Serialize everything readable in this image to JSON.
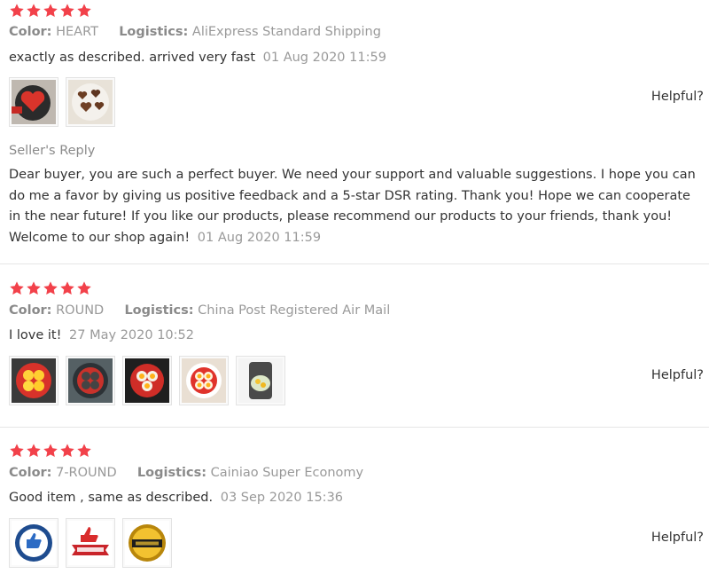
{
  "colors": {
    "star": "#f2414a",
    "text": "#333333",
    "muted": "#999999"
  },
  "reviews": [
    {
      "rating": 5,
      "color_label": "Color:",
      "color_value": "HEART",
      "logistics_label": "Logistics:",
      "logistics_value": "AliExpress Standard Shipping",
      "text": "exactly as described. arrived very fast",
      "date": "01 Aug 2020 11:59",
      "photos": [
        "pan-heart-photo",
        "heart-pancakes-photo"
      ],
      "helpful": "Helpful?",
      "seller_reply": {
        "title": "Seller's Reply",
        "text": "Dear buyer, you are such a perfect buyer. We need your support and valuable suggestions. I hope you can do me a favor by giving us positive feedback and a 5-star DSR rating. Thank you! Hope we can cooperate in the near future! If you like our products, please recommend our products to your friends, thank you! Welcome to our shop again!",
        "date": "01 Aug 2020 11:59"
      }
    },
    {
      "rating": 5,
      "color_label": "Color:",
      "color_value": "ROUND",
      "logistics_label": "Logistics:",
      "logistics_value": "China Post Registered Air Mail",
      "text": "I love it!",
      "date": "27 May 2020 10:52",
      "photos": [
        "pan-eggs-photo",
        "pan-mold-photo",
        "pan-eggs-closeup-photo",
        "plate-eggs-photo",
        "plate-eggs-side-photo"
      ],
      "helpful": "Helpful?"
    },
    {
      "rating": 5,
      "color_label": "Color:",
      "color_value": "7-ROUND",
      "logistics_label": "Logistics:",
      "logistics_value": "Cainiao Super Economy",
      "text": "Good item , same as described.",
      "date": "03 Sep 2020 15:36",
      "photos": [
        "recommended-badge-photo",
        "recommended-ribbon-photo",
        "best-seller-badge-photo"
      ],
      "helpful": "Helpful?"
    }
  ]
}
